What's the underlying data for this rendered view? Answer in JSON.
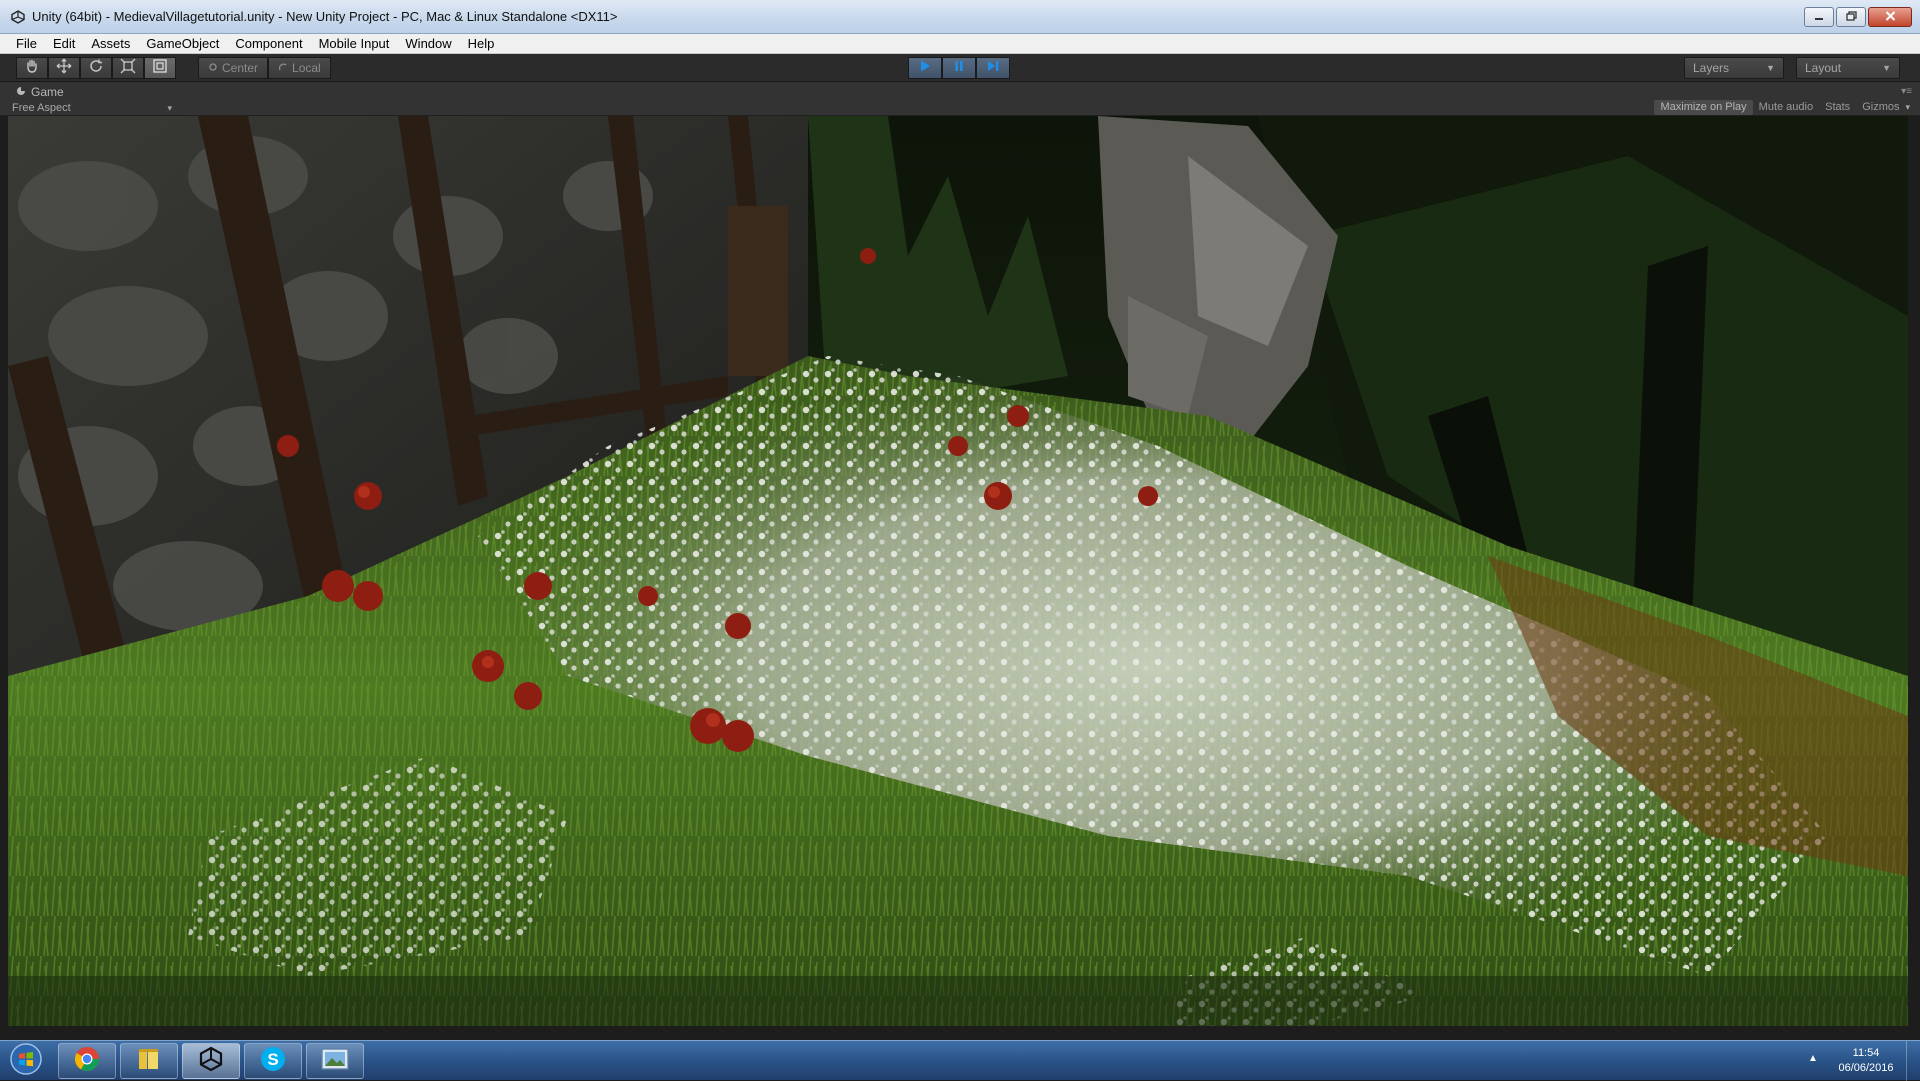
{
  "window": {
    "title": "Unity (64bit) - MedievalVillagetutorial.unity - New Unity Project - PC, Mac & Linux Standalone <DX11>",
    "minimize_icon": "minimize-icon",
    "maximize_icon": "restore-icon",
    "close_icon": "close-icon"
  },
  "menu": {
    "items": [
      "File",
      "Edit",
      "Assets",
      "GameObject",
      "Component",
      "Mobile Input",
      "Window",
      "Help"
    ]
  },
  "toolbar": {
    "tools": [
      "hand-icon",
      "move-icon",
      "rotate-icon",
      "scale-icon",
      "rect-tool-icon"
    ],
    "pivot_label": "Center",
    "rotation_label": "Local",
    "play_icon": "play-icon",
    "pause_icon": "pause-icon",
    "step_icon": "step-icon",
    "layers_label": "Layers",
    "layout_label": "Layout"
  },
  "game_view": {
    "tab_label": "Game",
    "aspect_label": "Free Aspect",
    "options": {
      "maximize_on_play": "Maximize on Play",
      "mute_audio": "Mute audio",
      "stats": "Stats",
      "gizmos": "Gizmos"
    }
  },
  "taskbar": {
    "apps": [
      "chrome-icon",
      "file-explorer-icon",
      "unity-icon",
      "skype-icon",
      "image-viewer-icon"
    ],
    "time": "11:54",
    "date": "06/06/2016"
  },
  "colors": {
    "unity_dark": "#2b2b2b",
    "play_blue": "#3f5268",
    "taskbar_blue": "#2a5489"
  }
}
